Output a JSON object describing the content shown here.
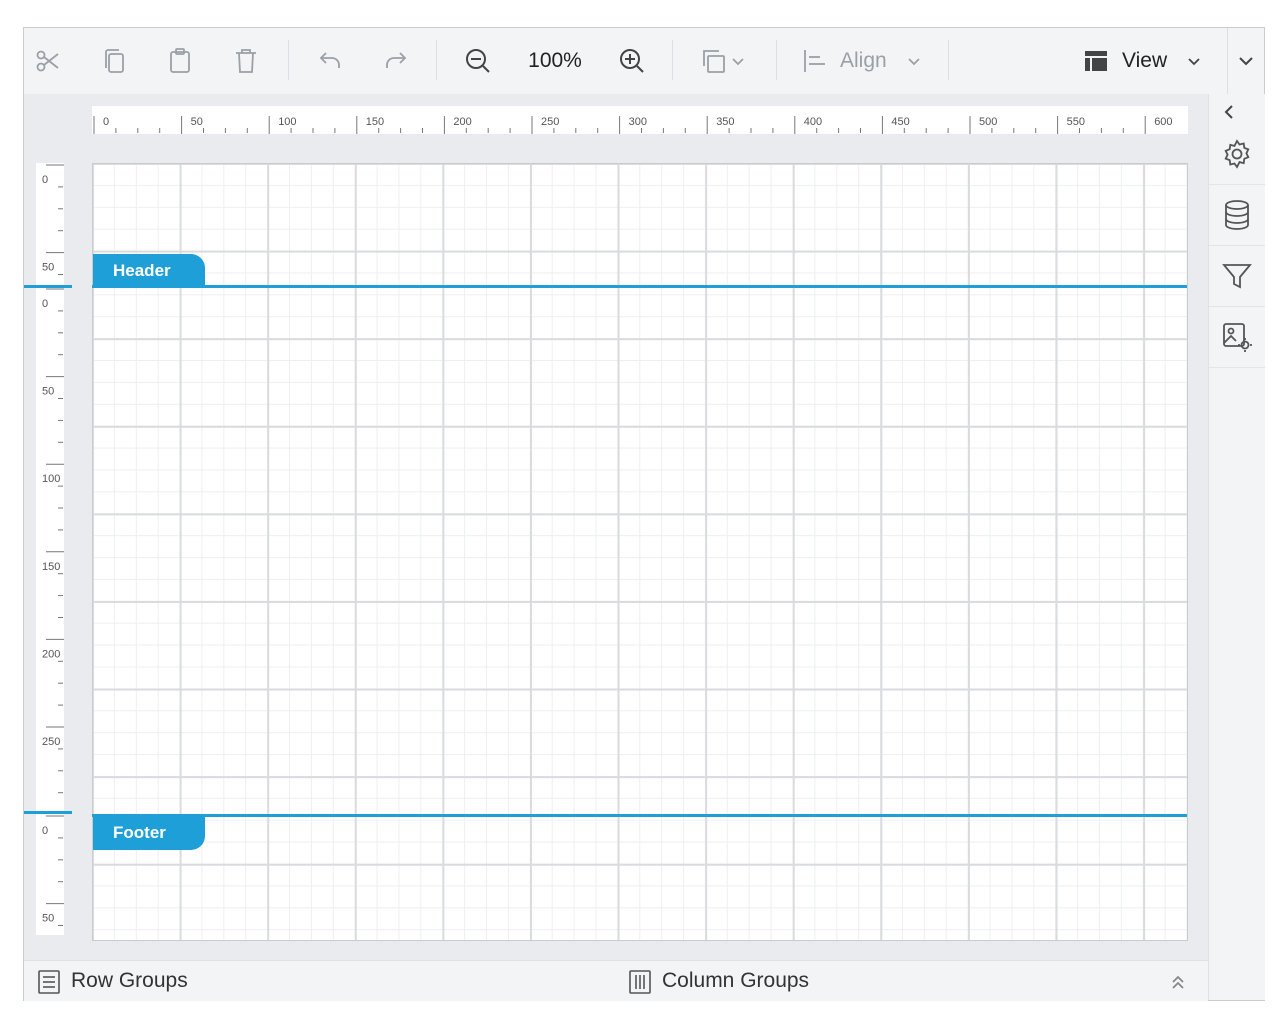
{
  "toolbar": {
    "cut_icon": "scissors-icon",
    "copy_icon": "copy-icon",
    "paste_icon": "paste-icon",
    "delete_icon": "trash-icon",
    "undo_icon": "undo-icon",
    "redo_icon": "redo-icon",
    "zoom_out_icon": "zoom-out-icon",
    "zoom_level": "100%",
    "zoom_in_icon": "zoom-in-icon",
    "order_icon": "bring-to-front-icon",
    "align_label": "Align",
    "view_label": "View",
    "view_icon": "layout-icon"
  },
  "rulers": {
    "horizontal_ticks": [
      "0",
      "50",
      "100",
      "150",
      "200",
      "250",
      "300",
      "350",
      "400",
      "450",
      "500",
      "550",
      "600"
    ],
    "header_ticks": [
      "0",
      "50"
    ],
    "body_ticks": [
      "0",
      "50",
      "100",
      "150",
      "200",
      "250"
    ],
    "footer_ticks": [
      "0",
      "50"
    ]
  },
  "bands": {
    "header": "Header",
    "footer": "Footer"
  },
  "right_panel": {
    "collapse_icon": "chevron-left-icon",
    "items": [
      "settings-icon",
      "database-icon",
      "filter-icon",
      "image-settings-icon"
    ]
  },
  "bottom": {
    "row_groups": "Row Groups",
    "column_groups": "Column Groups"
  },
  "colors": {
    "accent": "#1e9fd8",
    "toolbar_bg": "#f3f4f6",
    "icon_disabled": "#9aa0a6"
  }
}
